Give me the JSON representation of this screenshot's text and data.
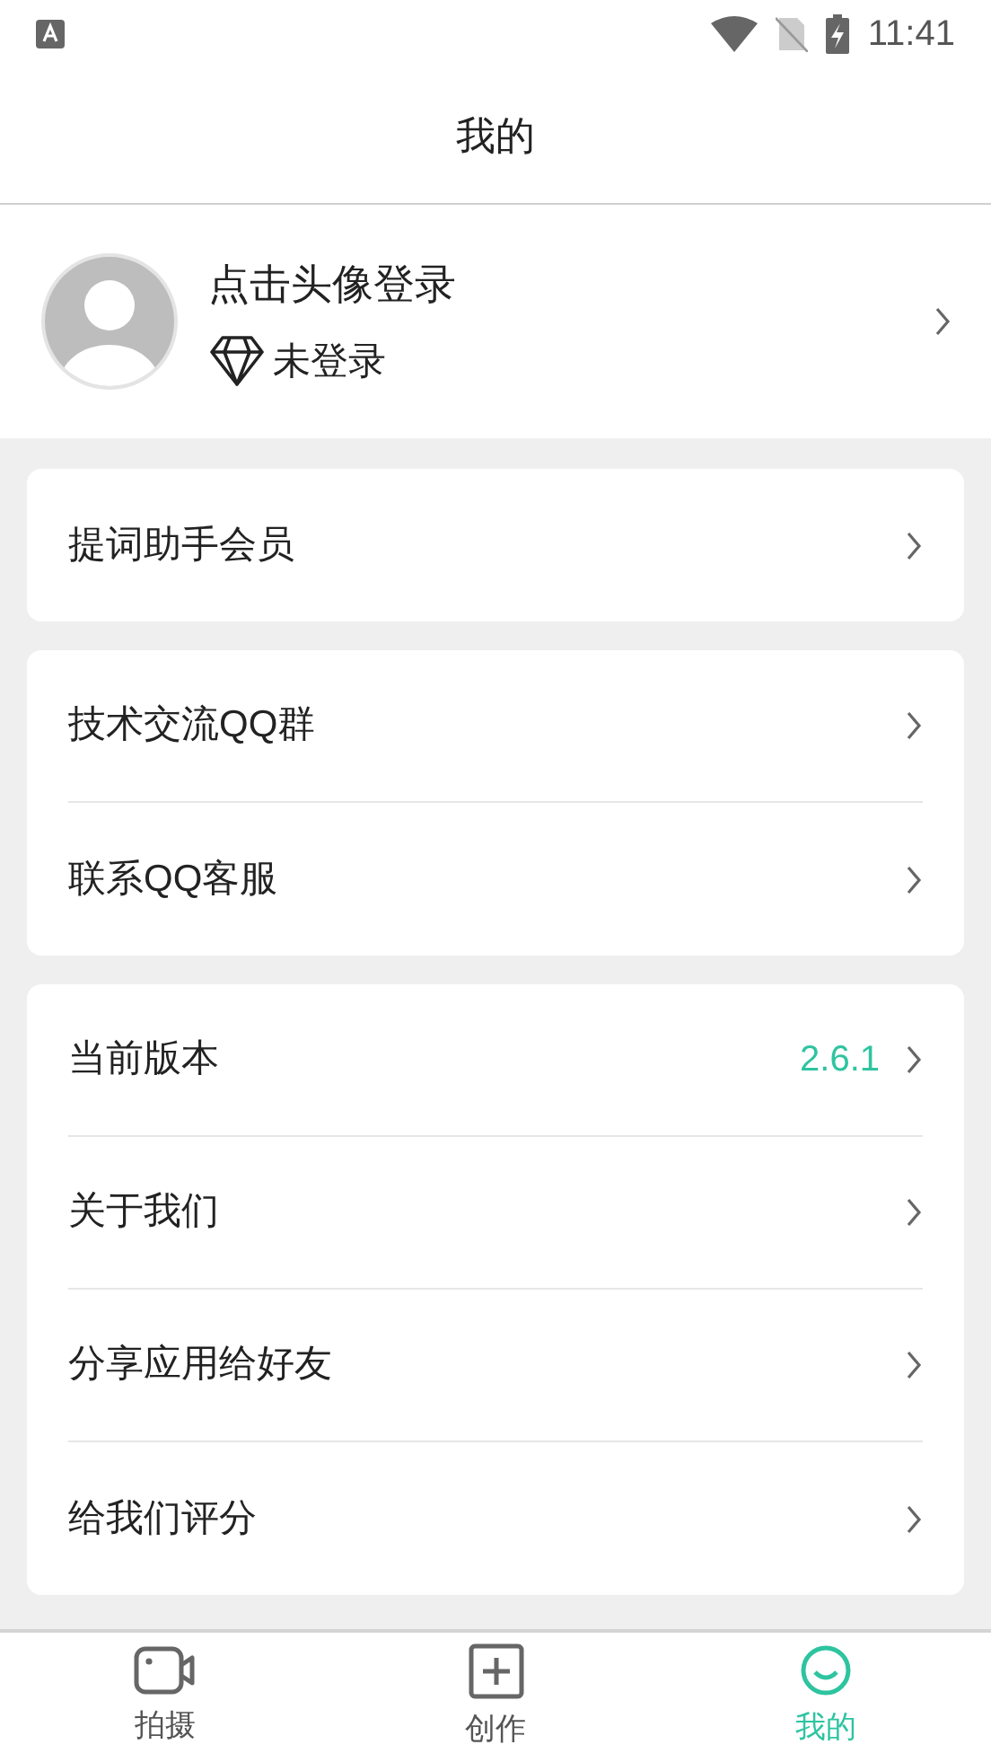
{
  "status_bar": {
    "time": "11:41"
  },
  "header": {
    "title": "我的"
  },
  "profile": {
    "name": "点击头像登录",
    "membership": "未登录"
  },
  "groups": [
    {
      "items": [
        {
          "label": "提词助手会员"
        }
      ]
    },
    {
      "items": [
        {
          "label": "技术交流QQ群"
        },
        {
          "label": "联系QQ客服"
        }
      ]
    },
    {
      "items": [
        {
          "label": "当前版本",
          "value": "2.6.1"
        },
        {
          "label": "关于我们"
        },
        {
          "label": "分享应用给好友"
        },
        {
          "label": "给我们评分"
        }
      ]
    }
  ],
  "tabs": [
    {
      "label": "拍摄",
      "kind": "camera",
      "selected": false
    },
    {
      "label": "创作",
      "kind": "plus",
      "selected": false
    },
    {
      "label": "我的",
      "kind": "person",
      "selected": true
    }
  ]
}
